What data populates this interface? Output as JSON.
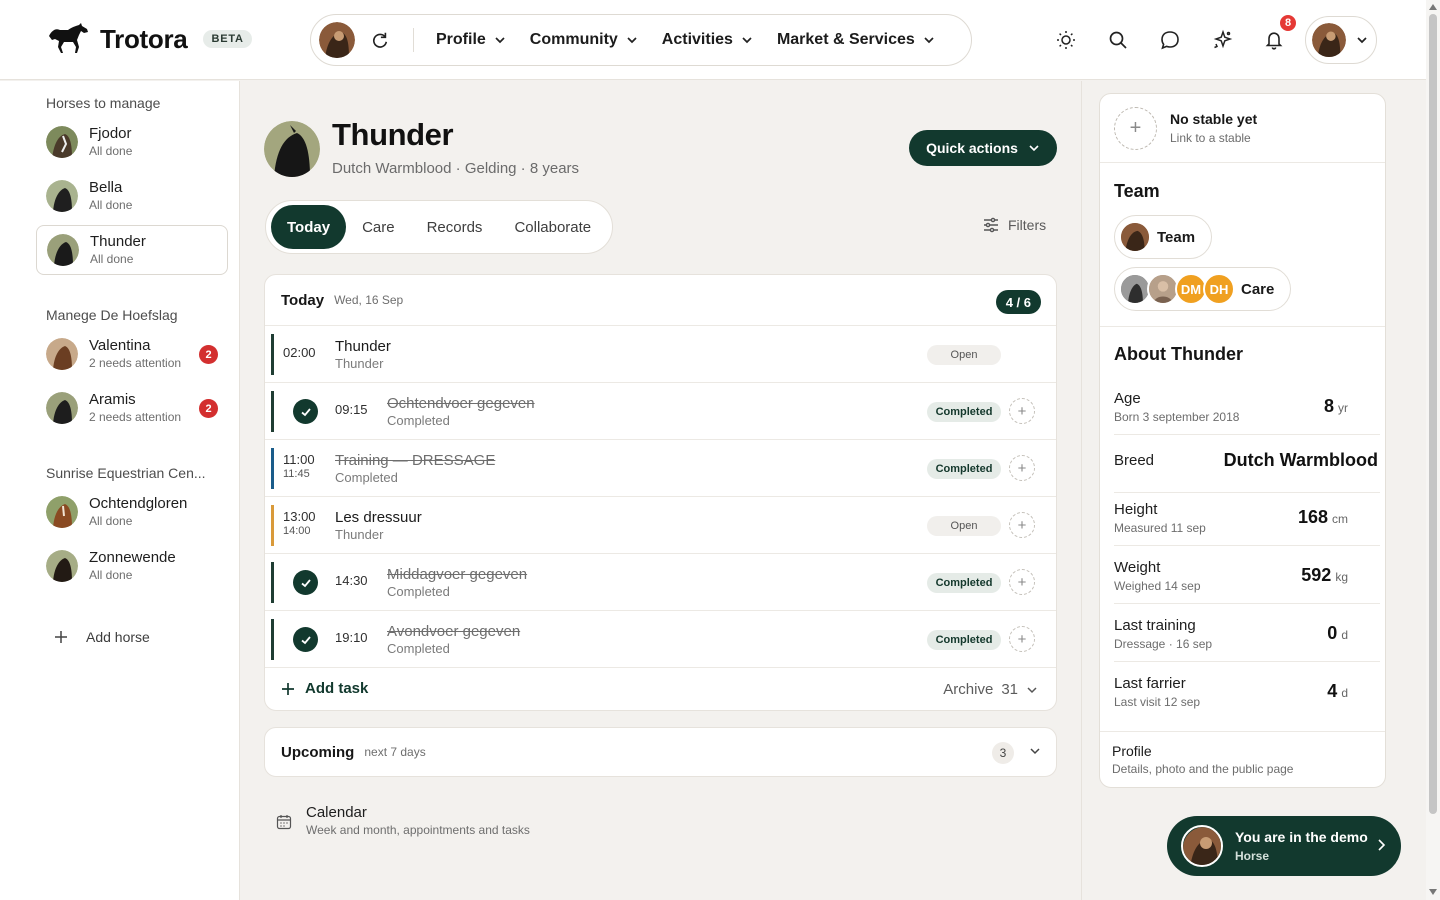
{
  "app": {
    "logo_text": "Trotora",
    "beta_label": "BETA"
  },
  "nav": {
    "items": [
      {
        "label": "Profile"
      },
      {
        "label": "Community"
      },
      {
        "label": "Activities"
      },
      {
        "label": "Market & Services"
      }
    ],
    "notification_count": "8",
    "icons": [
      "theme-icon",
      "search-icon",
      "chat-icon",
      "sparkle-icon",
      "bell-icon"
    ]
  },
  "sidebar": {
    "groups": [
      {
        "title": "Horses to manage",
        "horses": [
          {
            "name": "Fjodor",
            "status": "All done"
          },
          {
            "name": "Bella",
            "status": "All done"
          },
          {
            "name": "Thunder",
            "status": "All done"
          }
        ]
      },
      {
        "title": "Manege De Hoefslag",
        "horses": [
          {
            "name": "Valentina",
            "status": "2 needs attention",
            "badge": "2"
          },
          {
            "name": "Aramis",
            "status": "2 needs attention",
            "badge": "2"
          }
        ]
      },
      {
        "title": "Sunrise Equestrian Cen...",
        "horses": [
          {
            "name": "Ochtendgloren",
            "status": "All done"
          },
          {
            "name": "Zonnewende",
            "status": "All done"
          }
        ]
      }
    ],
    "add_horse_label": "Add horse"
  },
  "horse": {
    "name": "Thunder",
    "subtitle": "Dutch Warmblood · Gelding · 8 years",
    "quick_actions_label": "Quick actions"
  },
  "tabs": [
    {
      "label": "Today",
      "active": true
    },
    {
      "label": "Care"
    },
    {
      "label": "Records"
    },
    {
      "label": "Collaborate"
    }
  ],
  "filters_label": "Filters",
  "today": {
    "title": "Today",
    "date": "Wed, 16 Sep",
    "count": "4 / 6",
    "tasks": [
      {
        "time": "02:00",
        "title": "Thunder",
        "sub": "Thunder",
        "status": "Open"
      },
      {
        "time": "09:15",
        "title": "Ochtendvoer gegeven",
        "sub": "Completed",
        "status": "Completed"
      },
      {
        "time": "11:00",
        "end": "11:45",
        "title": "Training — DRESSAGE",
        "sub": "Completed",
        "status": "Completed"
      },
      {
        "time": "13:00",
        "end": "14:00",
        "title": "Les dressuur",
        "sub": "Thunder",
        "status": "Open"
      },
      {
        "time": "14:30",
        "title": "Middagvoer gegeven",
        "sub": "Completed",
        "status": "Completed"
      },
      {
        "time": "19:10",
        "title": "Avondvoer gegeven",
        "sub": "Completed",
        "status": "Completed"
      }
    ],
    "add_task_label": "Add task",
    "archive_label": "Archive",
    "archive_count": "31"
  },
  "upcoming": {
    "title": "Upcoming",
    "sub": "next 7 days",
    "count": "3"
  },
  "calendar": {
    "title": "Calendar",
    "sub": "Week and month, appointments and tasks"
  },
  "right": {
    "stable": {
      "title": "No stable yet",
      "sub": "Link to a stable"
    },
    "team_title": "Team",
    "team_chip_label": "Team",
    "care_chip_label": "Care",
    "care_initials": [
      "DM",
      "DH"
    ],
    "about_title": "About Thunder",
    "about": [
      {
        "label": "Age",
        "sub": "Born 3 september 2018",
        "value": "8",
        "unit": "yr"
      },
      {
        "label": "Breed",
        "value": "Dutch Warmblood"
      },
      {
        "label": "Height",
        "sub": "Measured 11 sep",
        "value": "168",
        "unit": "cm"
      },
      {
        "label": "Weight",
        "sub": "Weighed 14 sep",
        "value": "592",
        "unit": "kg"
      },
      {
        "label": "Last training",
        "sub": "Dressage · 16 sep",
        "value": "0",
        "unit": "d"
      },
      {
        "label": "Last farrier",
        "sub": "Last visit 12 sep",
        "value": "4",
        "unit": "d"
      }
    ],
    "profile": {
      "title": "Profile",
      "sub": "Details, photo and the public page"
    }
  },
  "demo": {
    "title": "You are in the demo",
    "sub": "Horse"
  },
  "colors": {
    "brand": "#12392e",
    "badge": "#d32f2f",
    "accent_orange": "#d99a3a",
    "accent_blue": "#1a5c8a"
  }
}
